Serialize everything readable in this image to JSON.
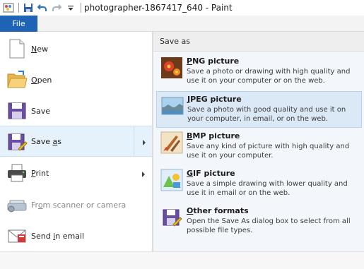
{
  "window": {
    "title": "photographer-1867417_640 - Paint"
  },
  "ribbon": {
    "file_tab": "File"
  },
  "menu": {
    "items": [
      {
        "label": "New",
        "icon": "new-document-icon",
        "interactable": true
      },
      {
        "label": "Open",
        "icon": "folder-open-icon",
        "interactable": true
      },
      {
        "label": "Save",
        "icon": "floppy-disk-icon",
        "interactable": true
      },
      {
        "label": "Save as",
        "icon": "save-as-icon",
        "interactable": true,
        "selected": true,
        "has_submenu": true
      },
      {
        "label": "Print",
        "icon": "printer-icon",
        "interactable": true,
        "has_submenu": true
      },
      {
        "label": "From scanner or camera",
        "icon": "scanner-icon",
        "interactable": false,
        "disabled": true
      },
      {
        "label": "Send in email",
        "icon": "email-icon",
        "interactable": true
      }
    ]
  },
  "save_as_panel": {
    "header": "Save as",
    "options": [
      {
        "title": "PNG picture",
        "description": "Save a photo or drawing with high quality and use it on your computer or on the web.",
        "icon": "png-flower-icon"
      },
      {
        "title": "JPEG picture",
        "description": "Save a photo with good quality and use it on your computer, in email, or on the web.",
        "icon": "jpeg-landscape-icon",
        "selected": true
      },
      {
        "title": "BMP picture",
        "description": "Save any kind of picture with high quality and use it on your computer.",
        "icon": "bmp-brushes-icon"
      },
      {
        "title": "GIF picture",
        "description": "Save a simple drawing with lower quality and use it in email or on the web.",
        "icon": "gif-shapes-icon"
      },
      {
        "title": "Other formats",
        "description": "Open the Save As dialog box to select from all possible file types.",
        "icon": "other-formats-icon"
      }
    ]
  },
  "colors": {
    "file_tab": "#1e63b5",
    "selection": "#e5f1fb"
  }
}
